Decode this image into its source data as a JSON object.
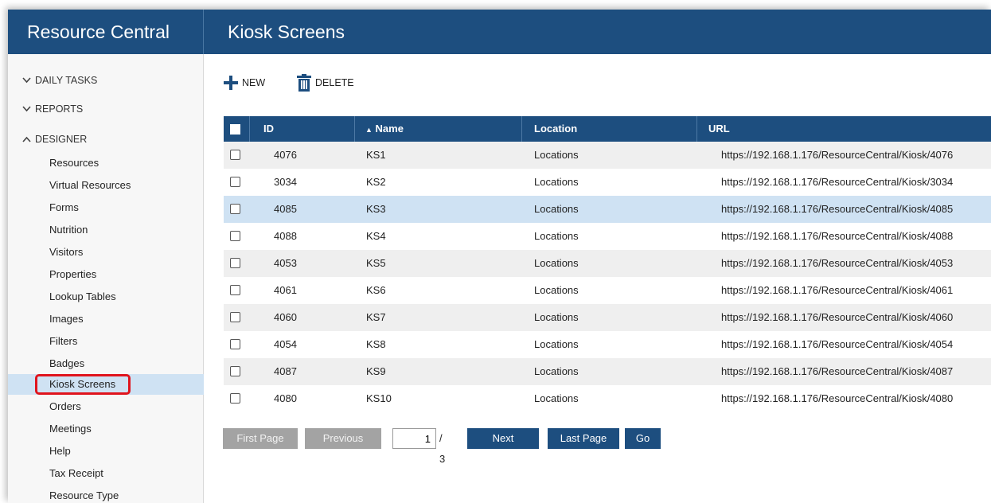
{
  "app": {
    "title": "Resource Central"
  },
  "page": {
    "title": "Kiosk Screens"
  },
  "sidebar": {
    "sections": [
      {
        "label": "DAILY TASKS",
        "state": "collapsed"
      },
      {
        "label": "REPORTS",
        "state": "collapsed"
      },
      {
        "label": "DESIGNER",
        "state": "expanded"
      }
    ],
    "items": [
      {
        "label": "Resources"
      },
      {
        "label": "Virtual Resources"
      },
      {
        "label": "Forms"
      },
      {
        "label": "Nutrition"
      },
      {
        "label": "Visitors"
      },
      {
        "label": "Properties"
      },
      {
        "label": "Lookup Tables"
      },
      {
        "label": "Images"
      },
      {
        "label": "Filters"
      },
      {
        "label": "Badges"
      },
      {
        "label": "Kiosk Screens",
        "active": true
      },
      {
        "label": "Orders"
      },
      {
        "label": "Meetings"
      },
      {
        "label": "Help"
      },
      {
        "label": "Tax Receipt"
      },
      {
        "label": "Resource Type"
      }
    ]
  },
  "toolbar": {
    "new_label": "NEW",
    "delete_label": "DELETE"
  },
  "table": {
    "columns": {
      "id": "ID",
      "name": "Name",
      "location": "Location",
      "url": "URL"
    },
    "sort_indicator": "▲",
    "rows": [
      {
        "id": "4076",
        "name": "KS1",
        "location": "Locations",
        "url": "https://192.168.1.176/ResourceCentral/Kiosk/4076"
      },
      {
        "id": "3034",
        "name": "KS2",
        "location": "Locations",
        "url": "https://192.168.1.176/ResourceCentral/Kiosk/3034"
      },
      {
        "id": "4085",
        "name": "KS3",
        "location": "Locations",
        "url": "https://192.168.1.176/ResourceCentral/Kiosk/4085",
        "selected": true
      },
      {
        "id": "4088",
        "name": "KS4",
        "location": "Locations",
        "url": "https://192.168.1.176/ResourceCentral/Kiosk/4088"
      },
      {
        "id": "4053",
        "name": "KS5",
        "location": "Locations",
        "url": "https://192.168.1.176/ResourceCentral/Kiosk/4053"
      },
      {
        "id": "4061",
        "name": "KS6",
        "location": "Locations",
        "url": "https://192.168.1.176/ResourceCentral/Kiosk/4061"
      },
      {
        "id": "4060",
        "name": "KS7",
        "location": "Locations",
        "url": "https://192.168.1.176/ResourceCentral/Kiosk/4060"
      },
      {
        "id": "4054",
        "name": "KS8",
        "location": "Locations",
        "url": "https://192.168.1.176/ResourceCentral/Kiosk/4054"
      },
      {
        "id": "4087",
        "name": "KS9",
        "location": "Locations",
        "url": "https://192.168.1.176/ResourceCentral/Kiosk/4087"
      },
      {
        "id": "4080",
        "name": "KS10",
        "location": "Locations",
        "url": "https://192.168.1.176/ResourceCentral/Kiosk/4080"
      }
    ]
  },
  "pager": {
    "first_label": "First Page",
    "previous_label": "Previous",
    "current_page": "1",
    "total_label": "/ 3",
    "next_label": "Next",
    "last_label": "Last Page",
    "go_label": "Go"
  },
  "colors": {
    "header": "#1d4e7f",
    "selected_row": "#cfe2f3",
    "highlight": "#e0141d",
    "disabled_button": "#a3a3a3"
  }
}
